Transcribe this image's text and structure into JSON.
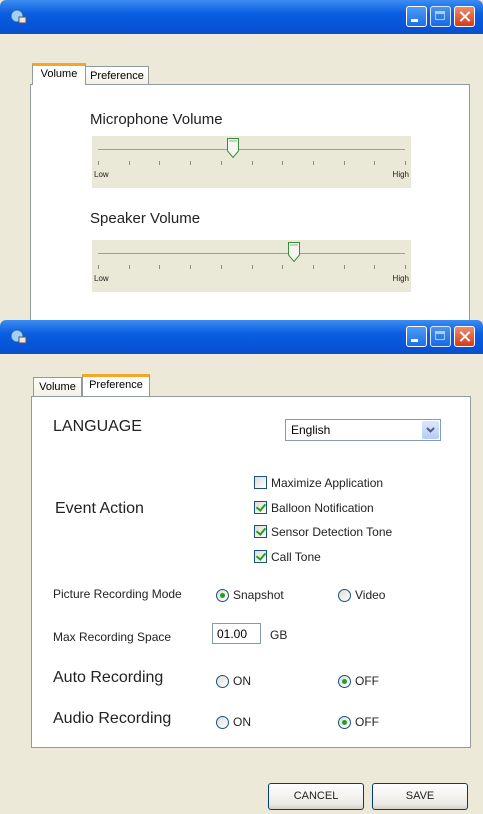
{
  "window1": {
    "tabs": [
      "Volume",
      "Preference"
    ],
    "mic": {
      "title": "Microphone Volume",
      "low": "Low",
      "high": "High",
      "level": 0.44
    },
    "speaker": {
      "title": "Speaker Volume",
      "low": "Low",
      "high": "High",
      "level": 0.64
    }
  },
  "window2": {
    "tabs": [
      "Volume",
      "Preference"
    ],
    "language": {
      "label": "LANGUAGE",
      "value": "English"
    },
    "event": {
      "label": "Event Action",
      "options": [
        {
          "label": "Maximize Application",
          "checked": false
        },
        {
          "label": "Balloon Notification",
          "checked": true
        },
        {
          "label": "Sensor Detection Tone",
          "checked": true
        },
        {
          "label": "Call Tone",
          "checked": true
        }
      ]
    },
    "picture_mode": {
      "label": "Picture Recording Mode",
      "snapshot": "Snapshot",
      "video": "Video",
      "selected": "snapshot"
    },
    "max_space": {
      "label": "Max Recording Space",
      "value": "01.00",
      "unit": "GB"
    },
    "auto_recording": {
      "label": "Auto Recording",
      "on": "ON",
      "off": "OFF",
      "selected": "off"
    },
    "audio_recording": {
      "label": "Audio Recording",
      "on": "ON",
      "off": "OFF",
      "selected": "off"
    },
    "buttons": {
      "cancel": "CANCEL",
      "save": "SAVE"
    }
  },
  "colors": {
    "titlebar": "#0a5ee0",
    "tab_highlight": "#f5a623",
    "check": "#21a121"
  }
}
